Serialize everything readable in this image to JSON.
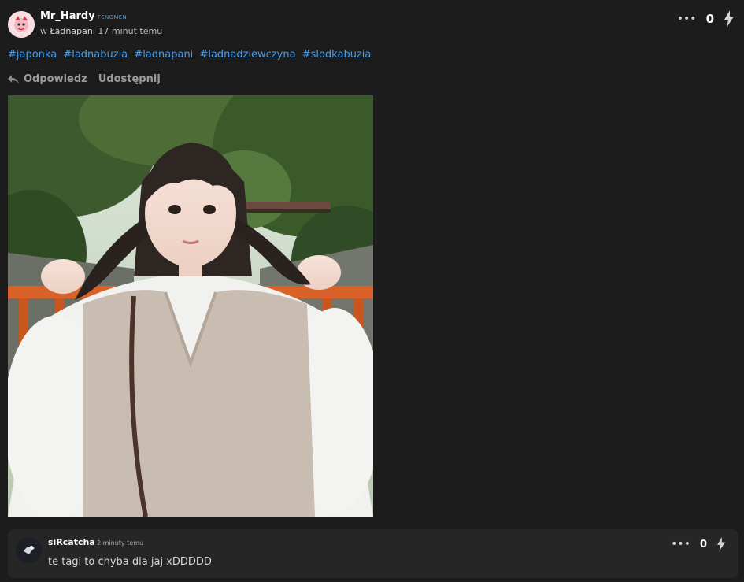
{
  "post": {
    "author": "Mr_Hardy",
    "rank": "FENOMEN",
    "meta_prefix": "w",
    "community": "Ładnapani",
    "time": "17 minut temu",
    "score": "0",
    "tags": [
      "#japonka",
      "#ladnabuzia",
      "#ladnapani",
      "#ladnadziewczyna",
      "#slodkabuzia"
    ],
    "actions": {
      "reply": "Odpowiedz",
      "share": "Udostępnij"
    },
    "icons": [
      "more-dots-icon",
      "bolt-icon",
      "reply-arrow-icon"
    ],
    "accent_color": "#4c9de8"
  },
  "comment": {
    "author": "siRcatcha",
    "time": "2 minuty temu",
    "text": "te tagi to chyba dla jaj xDDDDD",
    "score": "0"
  }
}
